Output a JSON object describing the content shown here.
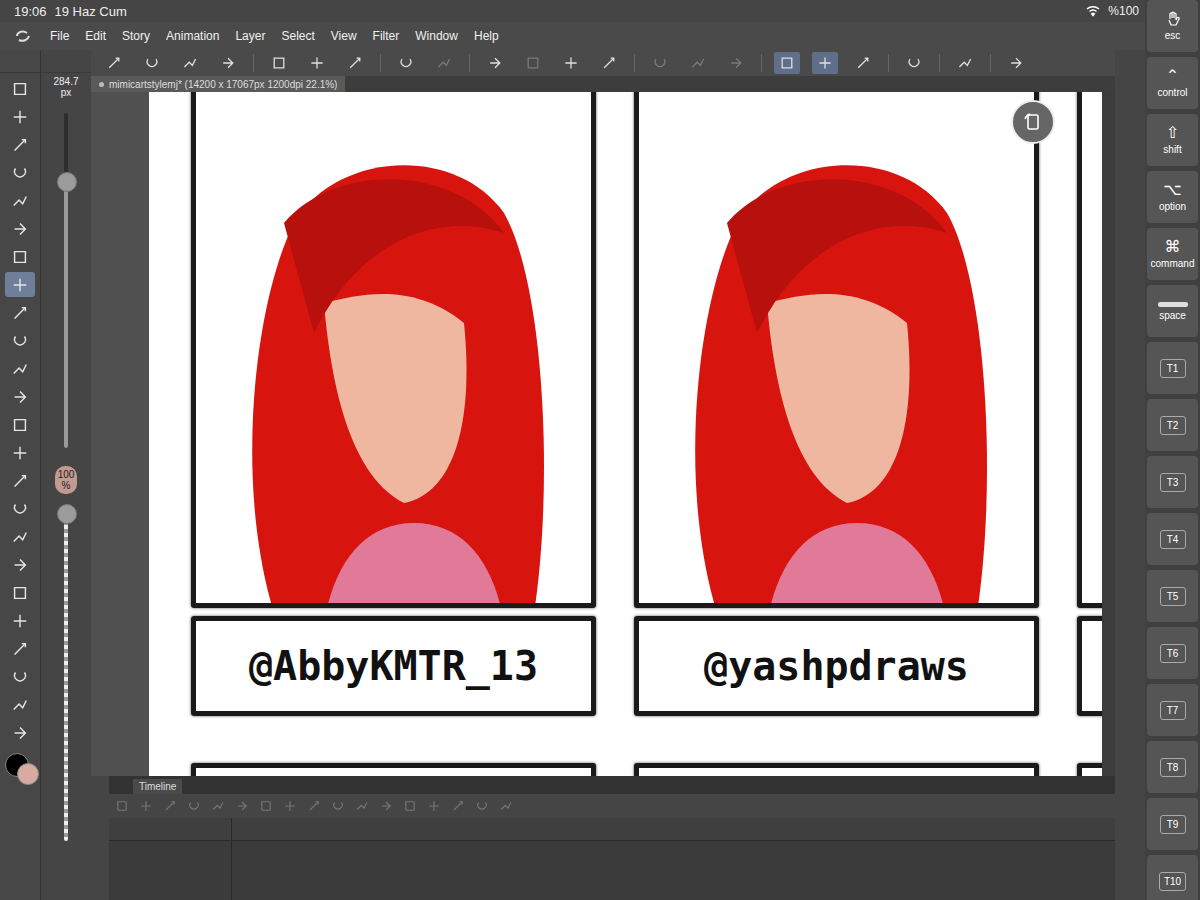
{
  "status_bar": {
    "time": "19:06",
    "date": "19 Haz Cum",
    "battery": "%100"
  },
  "menu": [
    "File",
    "Edit",
    "Story",
    "Animation",
    "Layer",
    "Select",
    "View",
    "Filter",
    "Window",
    "Help"
  ],
  "toolbar": [
    {
      "selected": false,
      "disabled": false
    },
    {
      "selected": false,
      "disabled": false
    },
    {
      "selected": false,
      "disabled": false
    },
    {
      "selected": false,
      "disabled": false
    },
    {
      "selected": false,
      "disabled": false
    },
    {
      "selected": false,
      "disabled": false
    },
    {
      "selected": false,
      "disabled": false
    },
    {
      "selected": false,
      "disabled": false
    },
    {
      "selected": false,
      "disabled": true
    },
    {
      "selected": false,
      "disabled": false
    },
    {
      "selected": false,
      "disabled": true
    },
    {
      "selected": false,
      "disabled": false
    },
    {
      "selected": false,
      "disabled": false
    },
    {
      "selected": false,
      "disabled": true
    },
    {
      "selected": false,
      "disabled": true
    },
    {
      "selected": false,
      "disabled": true
    },
    {
      "selected": true,
      "disabled": false
    },
    {
      "selected": true,
      "disabled": false
    },
    {
      "selected": false,
      "disabled": false
    },
    {
      "selected": false,
      "disabled": false
    },
    {
      "selected": false,
      "disabled": false
    },
    {
      "selected": false,
      "disabled": false
    }
  ],
  "document_tab": {
    "title": "mimicartstylemj* (14200 x 17067px 1200dpi 22.1%)"
  },
  "tools": [
    {
      "selected": false
    },
    {
      "selected": false
    },
    {
      "selected": false
    },
    {
      "selected": false
    },
    {
      "selected": false
    },
    {
      "selected": false
    },
    {
      "selected": false
    },
    {
      "selected": true
    },
    {
      "selected": false
    },
    {
      "selected": false
    },
    {
      "selected": false
    },
    {
      "selected": false
    },
    {
      "selected": false
    },
    {
      "selected": false
    },
    {
      "selected": false
    },
    {
      "selected": false
    },
    {
      "selected": false
    },
    {
      "selected": false
    },
    {
      "selected": false
    },
    {
      "selected": false
    },
    {
      "selected": false
    },
    {
      "selected": false
    },
    {
      "selected": false
    },
    {
      "selected": false
    }
  ],
  "brush_size": {
    "value": "284.7",
    "unit": "px",
    "level": 0.8
  },
  "opacity": {
    "value": "100",
    "unit": "%",
    "level": 1.0
  },
  "colors": {
    "main": "#000000",
    "sub": "#d9aaa0"
  },
  "canvas": {
    "panels": [
      {
        "name": "@AbbyKMTR_13"
      },
      {
        "name": "@yashpdraws"
      }
    ]
  },
  "timeline": {
    "tab": "Timeline"
  },
  "keys": [
    {
      "label": "esc",
      "kind": "plain"
    },
    {
      "label": "control",
      "kind": "glyph",
      "glyph": "⌃"
    },
    {
      "label": "shift",
      "kind": "glyph",
      "glyph": "⇧"
    },
    {
      "label": "option",
      "kind": "glyph",
      "glyph": "⌥"
    },
    {
      "label": "command",
      "kind": "glyph",
      "glyph": "⌘"
    },
    {
      "label": "space",
      "kind": "bar"
    },
    {
      "label": "T1",
      "kind": "box"
    },
    {
      "label": "T2",
      "kind": "box"
    },
    {
      "label": "T3",
      "kind": "box"
    },
    {
      "label": "T4",
      "kind": "box"
    },
    {
      "label": "T5",
      "kind": "box"
    },
    {
      "label": "T6",
      "kind": "box"
    },
    {
      "label": "T7",
      "kind": "box"
    },
    {
      "label": "T8",
      "kind": "box"
    },
    {
      "label": "T9",
      "kind": "box"
    },
    {
      "label": "T10",
      "kind": "box"
    }
  ]
}
